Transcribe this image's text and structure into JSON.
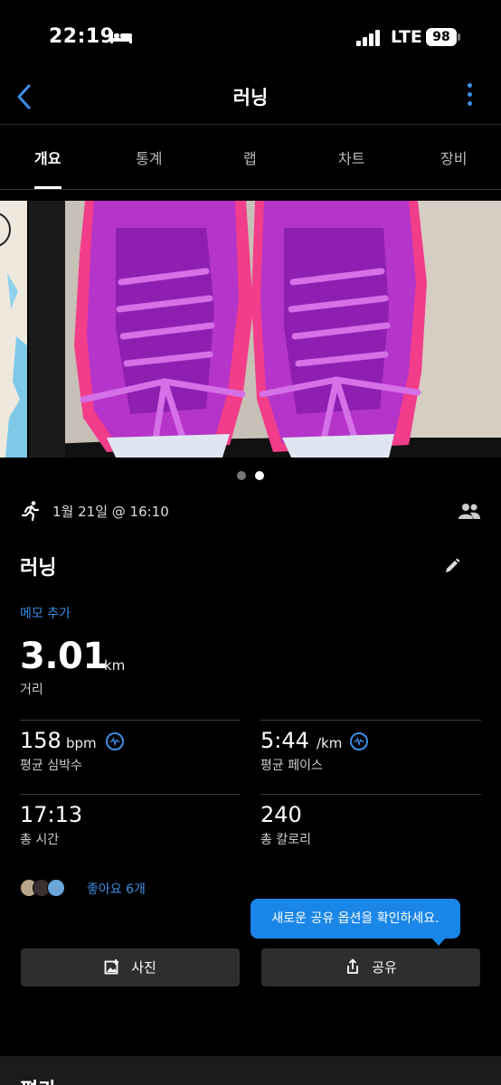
{
  "status": {
    "time": "22:19",
    "network": "LTE",
    "battery": "98"
  },
  "nav": {
    "title": "러닝"
  },
  "tabs": [
    {
      "label": "개요",
      "active": true
    },
    {
      "label": "통계"
    },
    {
      "label": "랩"
    },
    {
      "label": "차트"
    },
    {
      "label": "장비"
    }
  ],
  "carousel": {
    "photo_count": 2,
    "active_index": 1
  },
  "activity": {
    "date": "1월 21일 @ 16:10",
    "title": "러닝",
    "memo_link": "메모 추가",
    "distance": {
      "value": "3.01",
      "unit": "km",
      "label": "거리"
    }
  },
  "stats": [
    {
      "value": "158",
      "unit": "bpm",
      "label": "평균 심박수",
      "icon": "heart-rate-icon"
    },
    {
      "value": "5:44",
      "unit": "/km",
      "label": "평균 페이스",
      "icon": "heart-rate-icon"
    },
    {
      "value": "17:13",
      "unit": "",
      "label": "총 시간"
    },
    {
      "value": "240",
      "unit": "",
      "label": "총 칼로리"
    }
  ],
  "social": {
    "likes": "좋아요 6개"
  },
  "tooltip": "새로운 공유 옵션을 확인하세요.",
  "buttons": {
    "photo": "사진",
    "share": "공유"
  },
  "bottom": {
    "label": "평가"
  },
  "colors": {
    "accent": "#3d8ee6",
    "tooltip": "#1a86e8",
    "background": "#000000",
    "button": "#2e2e2e"
  }
}
